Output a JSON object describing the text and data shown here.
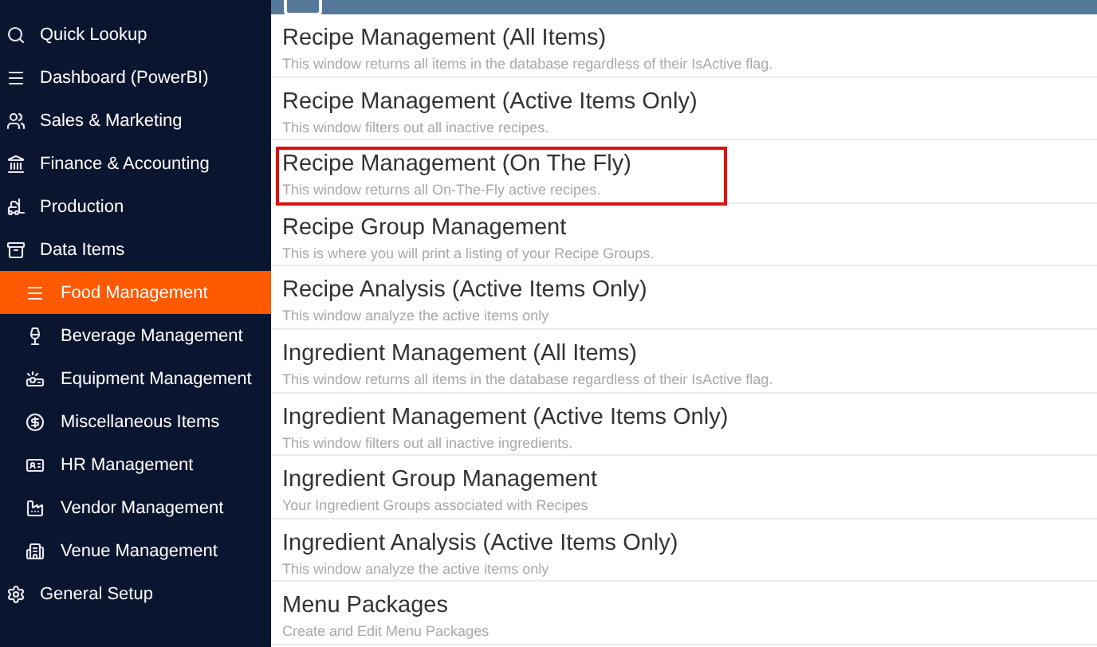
{
  "sidebar": {
    "items": [
      {
        "label": "Quick Lookup"
      },
      {
        "label": "Dashboard (PowerBI)"
      },
      {
        "label": "Sales & Marketing"
      },
      {
        "label": "Finance & Accounting"
      },
      {
        "label": "Production"
      },
      {
        "label": "Data Items",
        "children": [
          {
            "label": "Food Management",
            "selected": true
          },
          {
            "label": "Beverage Management",
            "selected": false
          },
          {
            "label": "Equipment Management",
            "selected": false
          },
          {
            "label": "Miscellaneous Items",
            "selected": false
          },
          {
            "label": "HR Management",
            "selected": false
          },
          {
            "label": "Vendor Management",
            "selected": false
          },
          {
            "label": "Venue Management",
            "selected": false
          }
        ]
      },
      {
        "label": "General Setup"
      }
    ]
  },
  "items": [
    {
      "title": "Recipe Management (All Items)",
      "description": "This window returns all items in the database regardless of their IsActive flag.",
      "highlighted": false
    },
    {
      "title": "Recipe Management (Active Items Only)",
      "description": "This window filters out all inactive recipes.",
      "highlighted": false
    },
    {
      "title": "Recipe Management (On The Fly)",
      "description": "This window returns all On-The-Fly active recipes.",
      "highlighted": true
    },
    {
      "title": "Recipe Group Management",
      "description": "This is where you will print a listing of your Recipe Groups.",
      "highlighted": false
    },
    {
      "title": "Recipe Analysis (Active Items Only)",
      "description": "This window analyze the active items only",
      "highlighted": false
    },
    {
      "title": "Ingredient Management (All Items)",
      "description": "This window returns all items in the database regardless of their IsActive flag.",
      "highlighted": false
    },
    {
      "title": "Ingredient Management (Active Items Only)",
      "description": "This window filters out all inactive ingredients.",
      "highlighted": false
    },
    {
      "title": "Ingredient Group Management",
      "description": "Your Ingredient Groups associated with Recipes",
      "highlighted": false
    },
    {
      "title": "Ingredient Analysis (Active Items Only)",
      "description": "This window analyze the active items only",
      "highlighted": false
    },
    {
      "title": "Menu Packages",
      "description": "Create and Edit Menu Packages",
      "highlighted": false
    }
  ]
}
